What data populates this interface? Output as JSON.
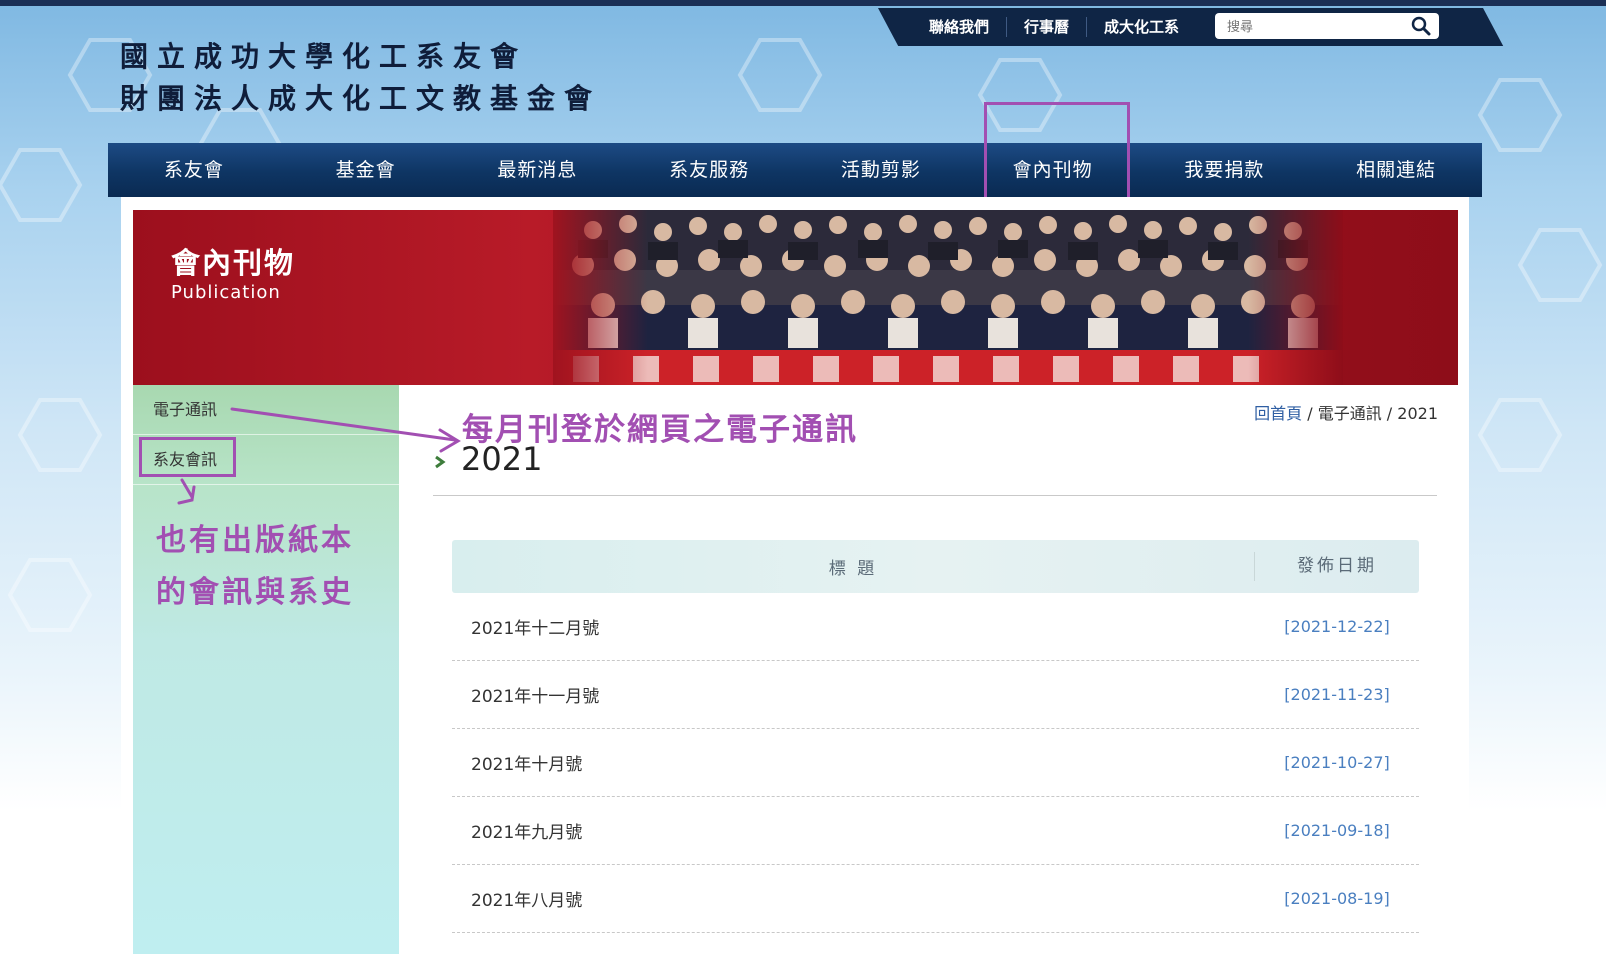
{
  "header": {
    "logo_line1": "國立成功大學化工系友會",
    "logo_line2": "財團法人成大化工文教基金會",
    "top_links": [
      "聯絡我們",
      "行事曆",
      "成大化工系"
    ],
    "search_placeholder": "搜尋"
  },
  "nav": {
    "items": [
      "系友會",
      "基金會",
      "最新消息",
      "系友服務",
      "活動剪影",
      "會內刊物",
      "我要捐款",
      "相關連結"
    ]
  },
  "banner": {
    "title": "會內刊物",
    "subtitle": "Publication"
  },
  "sidebar": {
    "items": [
      "電子通訊",
      "系友會訊"
    ]
  },
  "annotations": {
    "main_note": "每月刊登於網頁之電子通訊",
    "side_note_line1": "也有出版紙本",
    "side_note_line2": "的會訊與系史"
  },
  "page": {
    "title": "2021",
    "breadcrumb": {
      "home": "回首頁",
      "sep": " / ",
      "section": "電子通訊",
      "current": "2021"
    }
  },
  "table": {
    "col_title": "標 題",
    "col_date": "發佈日期",
    "rows": [
      {
        "title": "2021年十二月號",
        "date": "[2021-12-22]"
      },
      {
        "title": "2021年十一月號",
        "date": "[2021-11-23]"
      },
      {
        "title": "2021年十月號",
        "date": "[2021-10-27]"
      },
      {
        "title": "2021年九月號",
        "date": "[2021-09-18]"
      },
      {
        "title": "2021年八月號",
        "date": "[2021-08-19]"
      }
    ]
  },
  "colors": {
    "nav_bg": "#0e3563",
    "banner_red": "#b81b28",
    "annotation_purple": "#a24fb2",
    "date_blue": "#4a7fc0"
  }
}
